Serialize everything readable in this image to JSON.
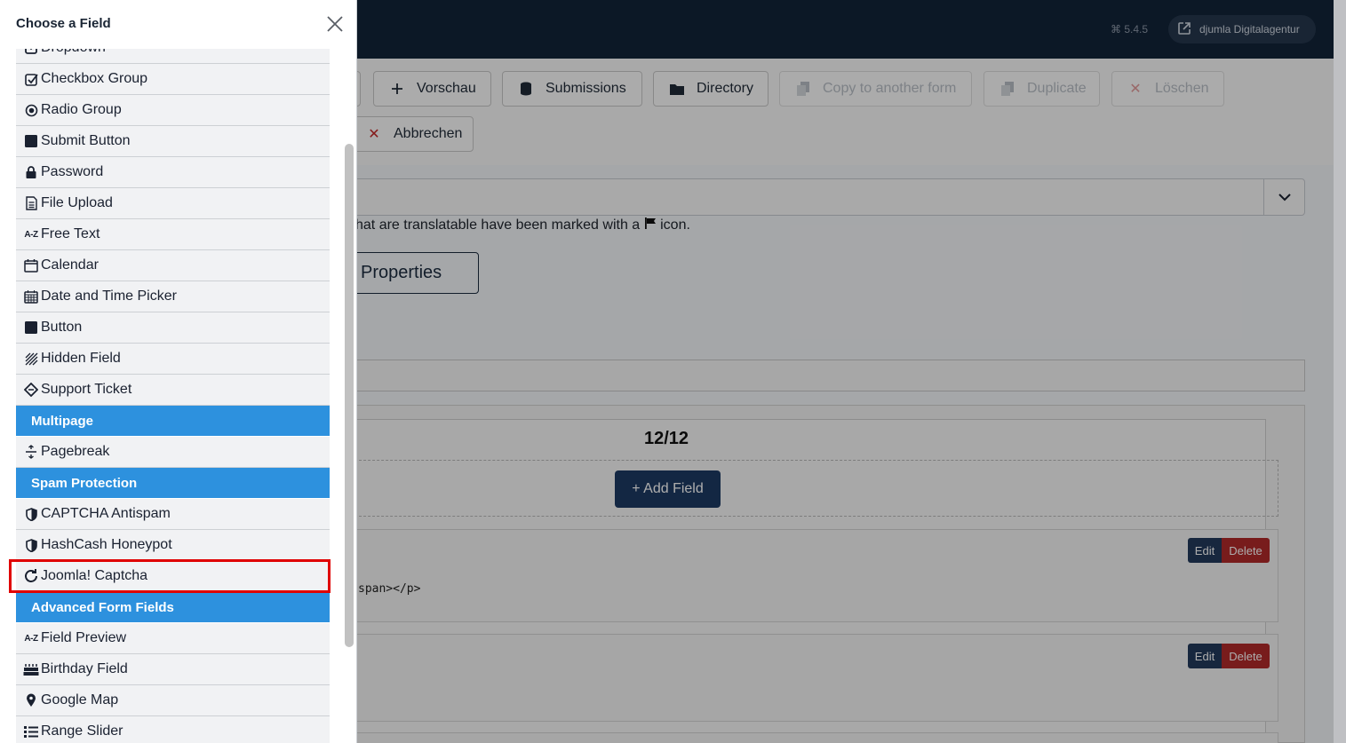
{
  "offcanvas": {
    "title": "Choose a Field",
    "items": [
      {
        "type": "item",
        "label": "Dropdown",
        "icon": "dropdown-icon"
      },
      {
        "type": "item",
        "label": "Checkbox Group",
        "icon": "checkbox-icon"
      },
      {
        "type": "item",
        "label": "Radio Group",
        "icon": "radio-icon"
      },
      {
        "type": "item",
        "label": "Submit Button",
        "icon": "square-icon"
      },
      {
        "type": "item",
        "label": "Password",
        "icon": "lock-icon"
      },
      {
        "type": "item",
        "label": "File Upload",
        "icon": "file-icon"
      },
      {
        "type": "item",
        "label": "Free Text",
        "icon": "az-icon"
      },
      {
        "type": "item",
        "label": "Calendar",
        "icon": "calendar-icon"
      },
      {
        "type": "item",
        "label": "Date and Time Picker",
        "icon": "calendar-grid-icon"
      },
      {
        "type": "item",
        "label": "Button",
        "icon": "square-icon"
      },
      {
        "type": "item",
        "label": "Hidden Field",
        "icon": "hatch-icon"
      },
      {
        "type": "item",
        "label": "Support Ticket",
        "icon": "ticket-icon"
      },
      {
        "type": "header",
        "label": "Multipage"
      },
      {
        "type": "item",
        "label": "Pagebreak",
        "icon": "pagebreak-icon"
      },
      {
        "type": "header",
        "label": "Spam Protection"
      },
      {
        "type": "item",
        "label": "CAPTCHA Antispam",
        "icon": "shield-icon"
      },
      {
        "type": "item",
        "label": "HashCash Honeypot",
        "icon": "shield-icon"
      },
      {
        "type": "item",
        "label": "Joomla! Captcha",
        "icon": "refresh-icon",
        "highlighted": true
      },
      {
        "type": "header",
        "label": "Advanced Form Fields"
      },
      {
        "type": "item",
        "label": "Field Preview",
        "icon": "az-icon"
      },
      {
        "type": "item",
        "label": "Birthday Field",
        "icon": "cake-icon"
      },
      {
        "type": "item",
        "label": "Google Map",
        "icon": "map-marker-icon"
      },
      {
        "type": "item",
        "label": "Range Slider",
        "icon": "list-icon"
      }
    ]
  },
  "topbar": {
    "version": "5.4.5",
    "site_label": "djumla Digitalagentur"
  },
  "toolbar": {
    "preview": "Vorschau",
    "submissions": "Submissions",
    "directory": "Directory",
    "copy": "Copy to another form",
    "duplicate": "Duplicate",
    "delete": "Löschen",
    "cancel": "Abbrechen"
  },
  "main": {
    "note_before": "hat are translatable have been marked with a",
    "note_after": "icon.",
    "properties": "Properties",
    "page_counter": "12/12",
    "add_field": "+ Add Field",
    "edit": "Edit",
    "delete": "Delete",
    "code_snippet": "span></p>"
  },
  "colors": {
    "accent": "#2d91de",
    "highlight": "#e00000",
    "topbar": "#132439",
    "danger": "#b12a2a"
  }
}
